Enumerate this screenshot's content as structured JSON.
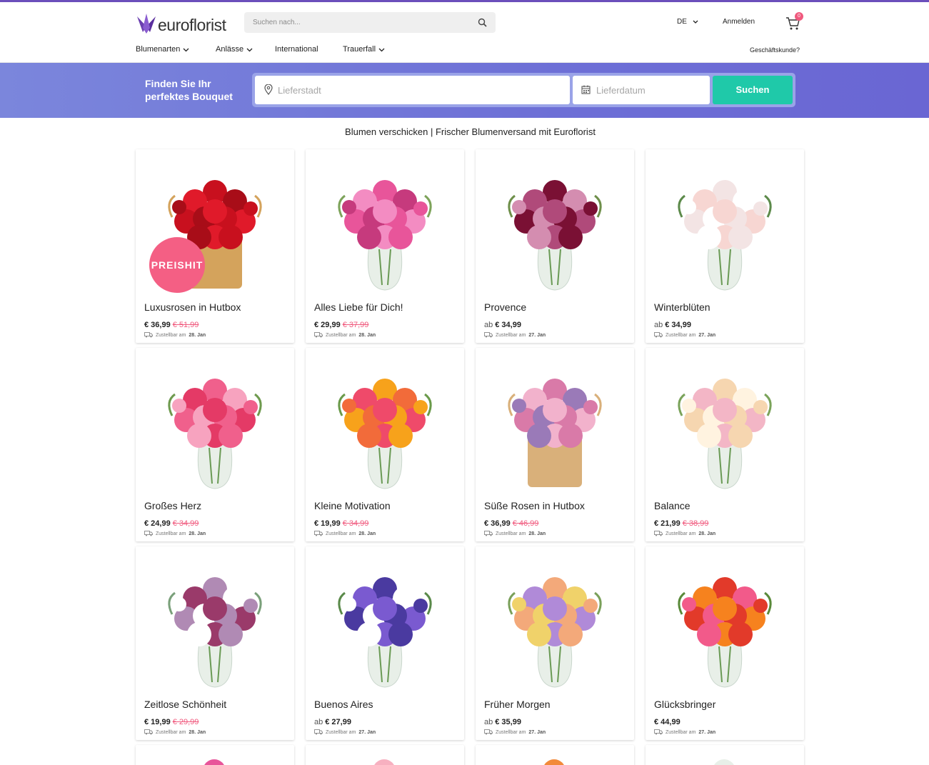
{
  "header": {
    "logo_text": "euroflorist",
    "search_placeholder": "Suchen nach...",
    "language": "DE",
    "signin": "Anmelden",
    "cart_count": "0",
    "business": "Geschäftskunde?",
    "nav": [
      {
        "label": "Blumenarten",
        "has_dropdown": true
      },
      {
        "label": "Anlässe",
        "has_dropdown": true
      },
      {
        "label": "International",
        "has_dropdown": false
      },
      {
        "label": "Trauerfall",
        "has_dropdown": true
      }
    ]
  },
  "hero": {
    "title": "Finden Sie Ihr perfektes Bouquet",
    "city_placeholder": "Lieferstadt",
    "date_placeholder": "Lieferdatum",
    "button": "Suchen"
  },
  "page_subtitle": "Blumen verschicken | Frischer Blumenversand mit Euroflorist",
  "colors": {
    "accent": "#6b4fbb",
    "hero": "#6d6fd6",
    "cta": "#1fc9a9",
    "sale": "#f05a7e"
  },
  "products": [
    {
      "name": "Luxusrosen in Hutbox",
      "from": "",
      "price": "€ 36,99",
      "old": "€ 51,99",
      "delivery_prefix": "Zustellbar am",
      "delivery_date": "28. Jan",
      "badge": "PREISHIT"
    },
    {
      "name": "Alles Liebe für Dich!",
      "from": "",
      "price": "€ 29,99",
      "old": "€ 37,99",
      "delivery_prefix": "Zustellbar am",
      "delivery_date": "28. Jan"
    },
    {
      "name": "Provence",
      "from": "ab",
      "price": "€ 34,99",
      "old": "",
      "delivery_prefix": "Zustellbar am",
      "delivery_date": "27. Jan"
    },
    {
      "name": "Winterblüten",
      "from": "ab",
      "price": "€ 34,99",
      "old": "",
      "delivery_prefix": "Zustellbar am",
      "delivery_date": "27. Jan"
    },
    {
      "name": "Großes Herz",
      "from": "",
      "price": "€ 24,99",
      "old": "€ 34,99",
      "delivery_prefix": "Zustellbar am",
      "delivery_date": "28. Jan"
    },
    {
      "name": "Kleine Motivation",
      "from": "",
      "price": "€ 19,99",
      "old": "€ 34,99",
      "delivery_prefix": "Zustellbar am",
      "delivery_date": "28. Jan"
    },
    {
      "name": "Süße Rosen in Hutbox",
      "from": "",
      "price": "€ 36,99",
      "old": "€ 46,99",
      "delivery_prefix": "Zustellbar am",
      "delivery_date": "28. Jan"
    },
    {
      "name": "Balance",
      "from": "",
      "price": "€ 21,99",
      "old": "€ 38,99",
      "delivery_prefix": "Zustellbar am",
      "delivery_date": "28. Jan"
    },
    {
      "name": "Zeitlose Schönheit",
      "from": "",
      "price": "€ 19,99",
      "old": "€ 29,99",
      "delivery_prefix": "Zustellbar am",
      "delivery_date": "28. Jan"
    },
    {
      "name": "Buenos Aires",
      "from": "ab",
      "price": "€ 27,99",
      "old": "",
      "delivery_prefix": "Zustellbar am",
      "delivery_date": "27. Jan"
    },
    {
      "name": "Früher Morgen",
      "from": "ab",
      "price": "€ 35,99",
      "old": "",
      "delivery_prefix": "Zustellbar am",
      "delivery_date": "27. Jan"
    },
    {
      "name": "Glücksbringer",
      "from": "",
      "price": "€ 44,99",
      "old": "",
      "delivery_prefix": "Zustellbar am",
      "delivery_date": "27. Jan"
    }
  ]
}
